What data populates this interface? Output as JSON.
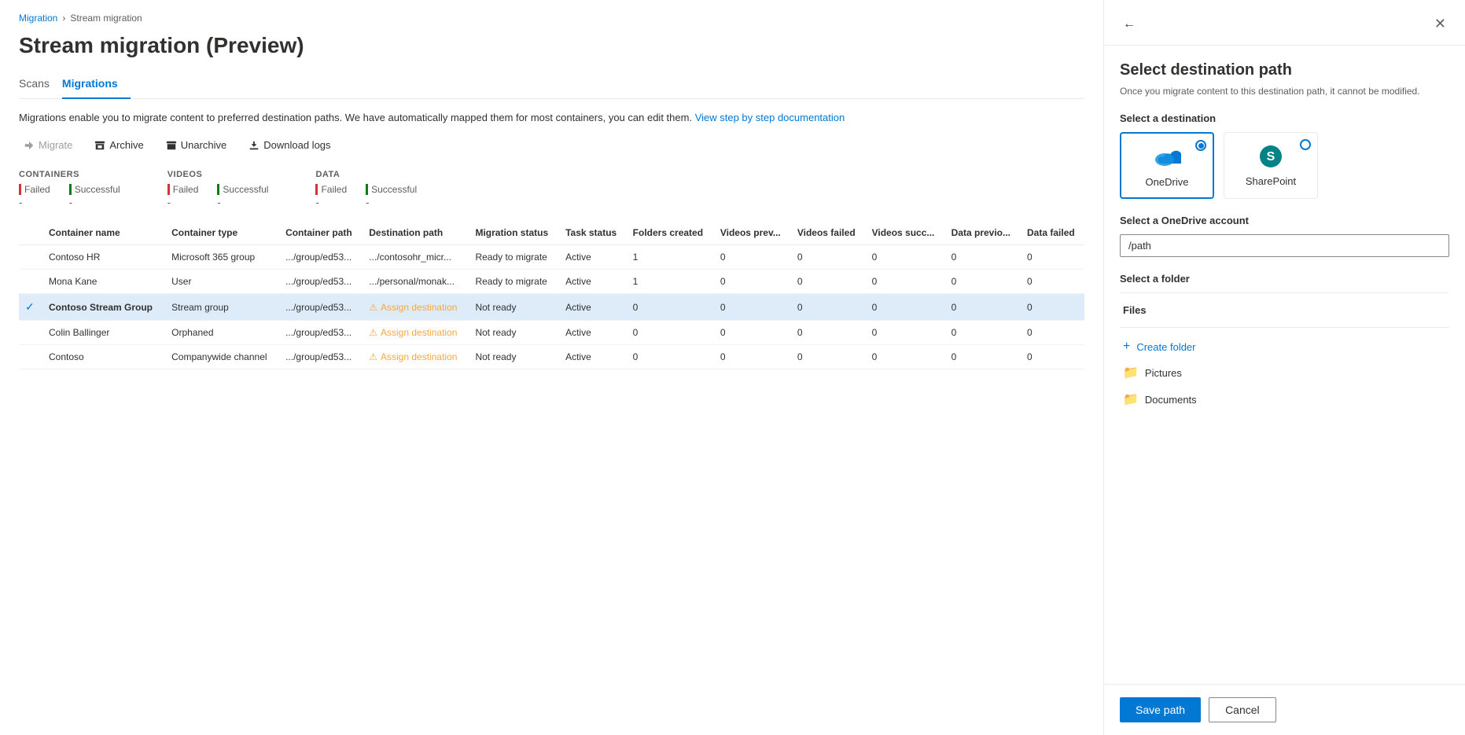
{
  "breadcrumb": {
    "parent": "Migration",
    "current": "Stream migration"
  },
  "page": {
    "title": "Stream migration (Preview)",
    "description": "Migrations enable you to migrate content to preferred destination paths. We have automatically mapped them for most containers, you can edit them.",
    "doc_link_text": "View step by step documentation"
  },
  "tabs": [
    {
      "id": "scans",
      "label": "Scans",
      "active": false
    },
    {
      "id": "migrations",
      "label": "Migrations",
      "active": true
    }
  ],
  "toolbar": {
    "migrate_label": "Migrate",
    "archive_label": "Archive",
    "unarchive_label": "Unarchive",
    "download_logs_label": "Download logs"
  },
  "stats": {
    "containers_label": "Containers",
    "videos_label": "Videos",
    "data_label": "Data",
    "failed_label": "Failed",
    "successful_label": "Successful",
    "dash": "-"
  },
  "table": {
    "columns": [
      "",
      "Container name",
      "Container type",
      "Container path",
      "Destination path",
      "Migration status",
      "Task status",
      "Folders created",
      "Videos prev...",
      "Videos failed",
      "Videos succ...",
      "Data previo...",
      "Data failed"
    ],
    "rows": [
      {
        "selected": false,
        "checked": false,
        "name": "Contoso HR",
        "type": "Microsoft 365 group",
        "path": ".../group/ed53...",
        "dest": ".../contosohr_micr...",
        "migration_status": "Ready to migrate",
        "task_status": "Active",
        "folders": "1",
        "videos_prev": "0",
        "videos_failed": "0",
        "videos_succ": "0",
        "data_prev": "0",
        "data_failed": "0"
      },
      {
        "selected": false,
        "checked": false,
        "name": "Mona Kane",
        "type": "User",
        "path": ".../group/ed53...",
        "dest": ".../personal/monak...",
        "migration_status": "Ready to migrate",
        "task_status": "Active",
        "folders": "1",
        "videos_prev": "0",
        "videos_failed": "0",
        "videos_succ": "0",
        "data_prev": "0",
        "data_failed": "0"
      },
      {
        "selected": true,
        "checked": true,
        "name": "Contoso Stream Group",
        "type": "Stream group",
        "path": ".../group/ed53...",
        "dest": "Assign destination",
        "migration_status": "Not ready",
        "task_status": "Active",
        "folders": "0",
        "videos_prev": "0",
        "videos_failed": "0",
        "videos_succ": "0",
        "data_prev": "0",
        "data_failed": "0"
      },
      {
        "selected": false,
        "checked": false,
        "name": "Colin Ballinger",
        "type": "Orphaned",
        "path": ".../group/ed53...",
        "dest": "Assign destination",
        "migration_status": "Not ready",
        "task_status": "Active",
        "folders": "0",
        "videos_prev": "0",
        "videos_failed": "0",
        "videos_succ": "0",
        "data_prev": "0",
        "data_failed": "0"
      },
      {
        "selected": false,
        "checked": false,
        "name": "Contoso",
        "type": "Companywide channel",
        "path": ".../group/ed53...",
        "dest": "Assign destination",
        "migration_status": "Not ready",
        "task_status": "Active",
        "folders": "0",
        "videos_prev": "0",
        "videos_failed": "0",
        "videos_succ": "0",
        "data_prev": "0",
        "data_failed": "0"
      }
    ]
  },
  "panel": {
    "title": "Select destination path",
    "subtitle": "Once you migrate content to this destination path, it cannot be modified.",
    "select_destination_label": "Select a destination",
    "onedrive_label": "OneDrive",
    "sharepoint_label": "SharePoint",
    "account_label": "Select a OneDrive account",
    "account_placeholder": "/path",
    "folder_label": "Select a folder",
    "files_label": "Files",
    "create_folder_label": "Create folder",
    "folder1": "Pictures",
    "folder2": "Documents",
    "save_label": "Save path",
    "cancel_label": "Cancel"
  }
}
